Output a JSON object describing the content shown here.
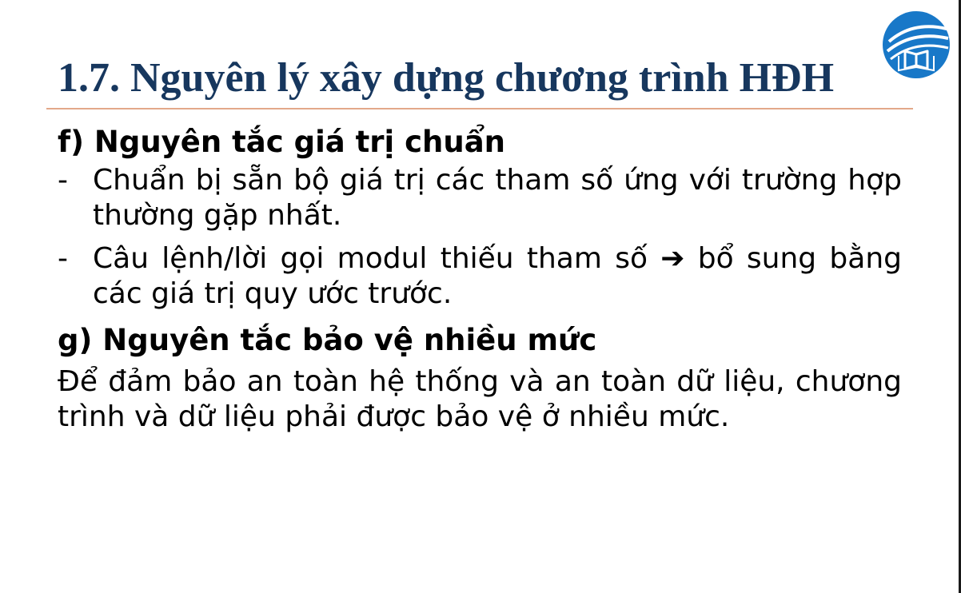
{
  "slide": {
    "title": "1.7. Nguyên lý xây dựng chương trình HĐH",
    "sections": [
      {
        "heading": "f) Nguyên tắc giá trị chuẩn",
        "bullets": [
          {
            "dash": "-",
            "text": "Chuẩn bị sẵn bộ giá trị các tham số ứng với trường hợp thường gặp nhất."
          },
          {
            "dash": "-",
            "text_before_arrow": "Câu lệnh/lời gọi modul thiếu tham số",
            "arrow": "➔",
            "text_after_arrow": "bổ sung bằng các giá trị quy ước trước."
          }
        ]
      },
      {
        "heading": "g) Nguyên tắc bảo vệ nhiều mức",
        "paragraph": "Để đảm bảo an toàn hệ thống và an toàn dữ liệu, chương trình và dữ liệu phải được bảo vệ ở nhiều mức."
      }
    ]
  },
  "logo": {
    "icon": "book-globe-logo-icon",
    "color": "#1878c8"
  },
  "colors": {
    "title": "#17375e",
    "divider": "#e3a88a",
    "text": "#000000"
  }
}
